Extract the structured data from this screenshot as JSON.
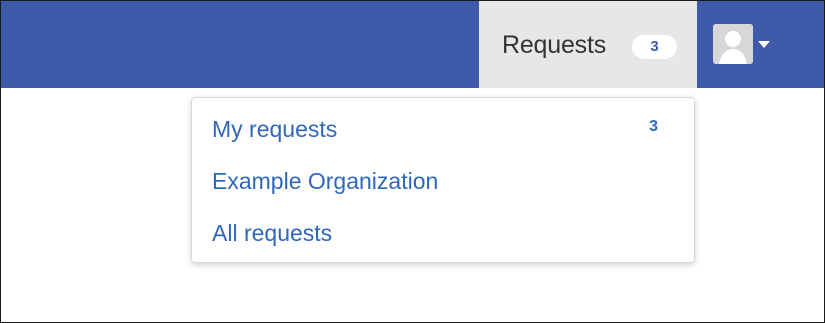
{
  "header": {
    "requests_label": "Requests",
    "requests_count": "3",
    "avatar_icon": "user-avatar-icon",
    "dropdown_icon": "chevron-down-icon",
    "colors": {
      "navbar": "#3f5aa8",
      "active_tab": "#e7e7e7",
      "link": "#2f68b8",
      "badge_text": "#3f5aa8"
    }
  },
  "menu": {
    "items": [
      {
        "label": "My requests",
        "count": "3"
      },
      {
        "label": "Example Organization",
        "count": ""
      },
      {
        "label": "All requests",
        "count": ""
      }
    ]
  }
}
